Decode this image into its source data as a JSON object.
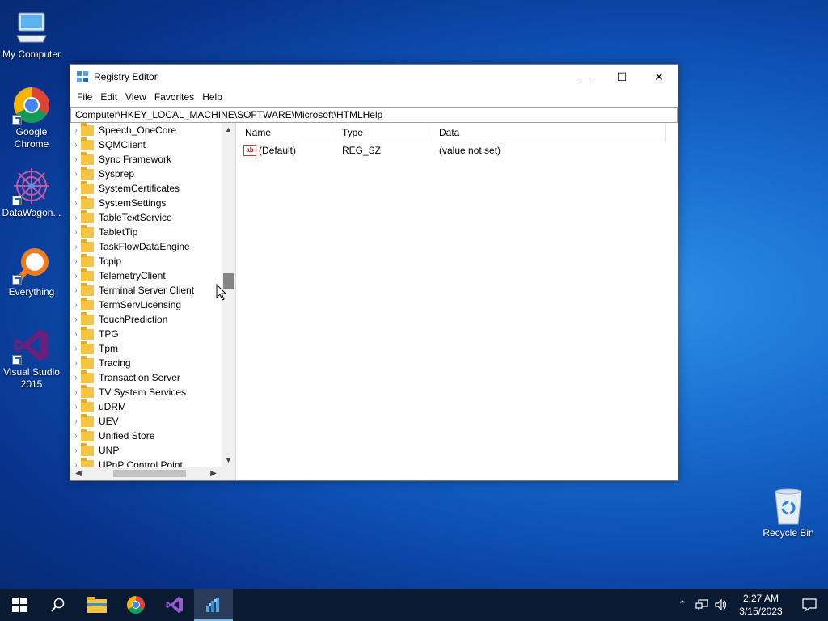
{
  "desktop": {
    "icons": [
      {
        "label": "My Computer"
      },
      {
        "label": "Google Chrome"
      },
      {
        "label": "DataWagon..."
      },
      {
        "label": "Everything"
      },
      {
        "label": "Visual Studio 2015"
      },
      {
        "label": "Recycle Bin"
      }
    ]
  },
  "window": {
    "title": "Registry Editor",
    "minimize_glyph": "—",
    "maximize_glyph": "☐",
    "close_glyph": "✕",
    "menu": [
      "File",
      "Edit",
      "View",
      "Favorites",
      "Help"
    ],
    "address": "Computer\\HKEY_LOCAL_MACHINE\\SOFTWARE\\Microsoft\\HTMLHelp",
    "tree": [
      "Speech_OneCore",
      "SQMClient",
      "Sync Framework",
      "Sysprep",
      "SystemCertificates",
      "SystemSettings",
      "TableTextService",
      "TabletTip",
      "TaskFlowDataEngine",
      "Tcpip",
      "TelemetryClient",
      "Terminal Server Client",
      "TermServLicensing",
      "TouchPrediction",
      "TPG",
      "Tpm",
      "Tracing",
      "Transaction Server",
      "TV System Services",
      "uDRM",
      "UEV",
      "Unified Store",
      "UNP",
      "UPnP Control Point"
    ],
    "list": {
      "columns": [
        "Name",
        "Type",
        "Data"
      ],
      "rows": [
        {
          "name": "(Default)",
          "type": "REG_SZ",
          "data": "(value not set)",
          "icon": "string-value-icon"
        }
      ]
    }
  },
  "taskbar": {
    "apps": [
      "start-icon",
      "search-icon",
      "file-explorer-icon",
      "chrome-icon",
      "visual-studio-icon",
      "registry-editor-icon"
    ],
    "time": "2:27 AM",
    "date": "3/15/2023",
    "tray_chevron": "⌃"
  }
}
